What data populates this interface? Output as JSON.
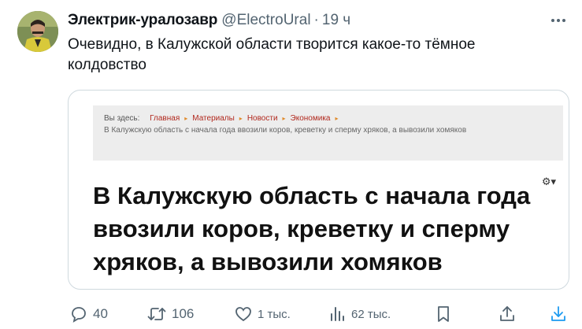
{
  "tweet": {
    "author_name": "Электрик-уралозавр",
    "handle": "@ElectroUral",
    "separator": "·",
    "time": "19 ч",
    "text": "Очевидно, в Калужской области творится какое-то тёмное колдовство"
  },
  "card": {
    "breadcrumb_prefix": "Вы здесь:",
    "breadcrumbs": [
      "Главная",
      "Материалы",
      "Новости",
      "Экономика"
    ],
    "breadcrumb_current": "В Калужскую область с начала года ввозили коров, креветку и сперму хряков, а вывозили хомяков",
    "title": "В Калужскую область с начала года ввозили коров, креветку и сперму хряков, а вывозили хомяков"
  },
  "actions": {
    "replies": "40",
    "retweets": "106",
    "likes": "1 тыс.",
    "views": "62 тыс."
  },
  "icons": {
    "more": "more-icon",
    "reply": "reply-icon",
    "retweet": "retweet-icon",
    "like": "heart-icon",
    "views": "views-chart-icon",
    "bookmark": "bookmark-icon",
    "share": "share-icon",
    "download": "download-icon"
  },
  "colors": {
    "text": "#0f1419",
    "secondary": "#536471",
    "breadcrumb_link": "#b1281d",
    "download_accent": "#1d9bf0"
  }
}
